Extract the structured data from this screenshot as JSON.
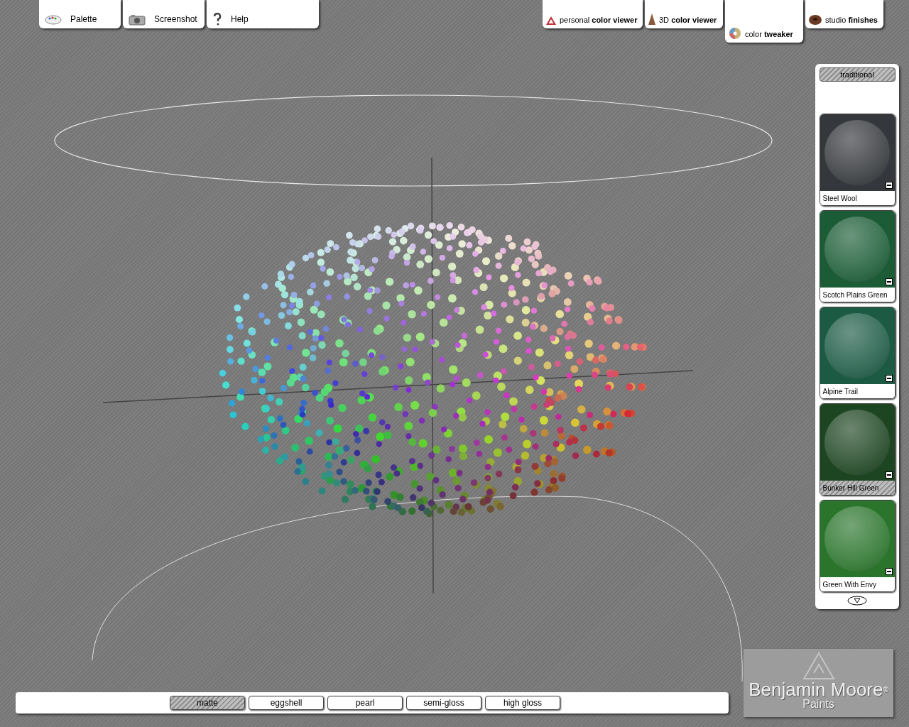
{
  "left_tabs": [
    {
      "kind": "palette",
      "label": "Palette"
    },
    {
      "kind": "camera",
      "label": "Screenshot"
    },
    {
      "kind": "help",
      "label": "Help"
    }
  ],
  "right_tabs": [
    {
      "kind": "triangle",
      "label": "personal **color viewer**",
      "selected": false
    },
    {
      "kind": "cone",
      "label": "3D **color viewer**",
      "selected": false
    },
    {
      "kind": "wheel",
      "label": "color **tweaker**",
      "selected": true
    },
    {
      "kind": "donut",
      "label": "studio **finishes**",
      "selected": false
    }
  ],
  "sidebar": {
    "collection": "traditional",
    "swatches": [
      {
        "name": "Steel Wool",
        "color": "#34373b",
        "selected": false
      },
      {
        "name": "Scotch Plains Green",
        "color": "#1b5c36",
        "selected": false
      },
      {
        "name": "Alpine Trail",
        "color": "#1c5a44",
        "selected": false
      },
      {
        "name": "Bunker Hill Green",
        "color": "#1e4522",
        "selected": true
      },
      {
        "name": "Green With Envy",
        "color": "#2a742c",
        "selected": false
      }
    ]
  },
  "finishes": [
    {
      "label": "matte",
      "selected": true
    },
    {
      "label": "eggshell",
      "selected": false
    },
    {
      "label": "pearl",
      "selected": false
    },
    {
      "label": "semi-gloss",
      "selected": false
    },
    {
      "label": "high gloss",
      "selected": false
    }
  ],
  "logo": {
    "name": "Benjamin Moore",
    "mark": "®",
    "sub": "Paints"
  }
}
